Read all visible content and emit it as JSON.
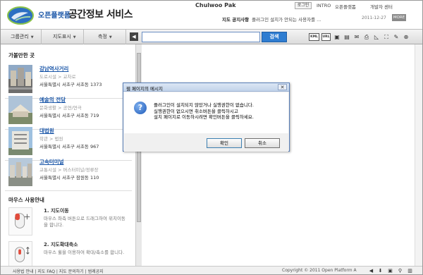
{
  "header": {
    "brand": "오픈플랫폼",
    "title": "공간정보 서비스",
    "user_name": "Chulwoo Pak",
    "login_label": "로그인",
    "links": [
      "INTRO",
      "오픈플랫폼",
      "개발자 센터"
    ],
    "notice_label": "지도 공지사항",
    "notice_text": "플러그인 설치가 안되는 사용자를 ...",
    "notice_date": "2011-12-27",
    "notice_more": "MORE"
  },
  "toolbar": {
    "menus": [
      "그룹관리",
      "지도표시",
      "측정"
    ],
    "collapse_glyph": "◀",
    "search_value": "",
    "search_button": "검색",
    "tools": [
      "KML",
      "URL"
    ]
  },
  "sidebar": {
    "favorites_title": "가볼만한 곳",
    "places": [
      {
        "name": "강남역사거리",
        "category": "도로시설 > 교차로",
        "address": "서울특별시 서초구 서초동 1373"
      },
      {
        "name": "예술의 전당",
        "category": "문화생활 > 공연/연극",
        "address": "서울특별시 서초구 서초동 719"
      },
      {
        "name": "대법원",
        "category": "학관 > 법원",
        "address": "서울특별시 서초구 서초동 967"
      },
      {
        "name": "고속터미널",
        "category": "교통시설 > 버스터미널/정류장",
        "address": "서울특별시 서초구 잠원동 110"
      }
    ],
    "guide_title": "마우스 사용안내",
    "guides": [
      {
        "title": "1. 지도이동",
        "desc": "마우스 좌측 버튼으로 드래그하여 위치이동을 합니다."
      },
      {
        "title": "2. 지도확대축소",
        "desc": "마우스 휠을 이용하여 확대/축소를 합니다."
      }
    ]
  },
  "dialog": {
    "title": "웹 페이지의 메시지",
    "close": "✕",
    "icon_glyph": "?",
    "lines": [
      "플러그인이 설치되지 않았거나 실행권한이 없습니다.",
      "실행권한이 없으시면 취소버튼을 클릭하시고",
      "설치 페이지로 이동하시려면 확인버튼을 클릭하세요."
    ],
    "ok_label": "확인",
    "cancel_label": "취소"
  },
  "footer": {
    "links": "사용법 안내 | 지도 FAQ | 지도 문의하기 | 범례공지",
    "copyright": "Copyright © 2011 Open Platform A"
  }
}
